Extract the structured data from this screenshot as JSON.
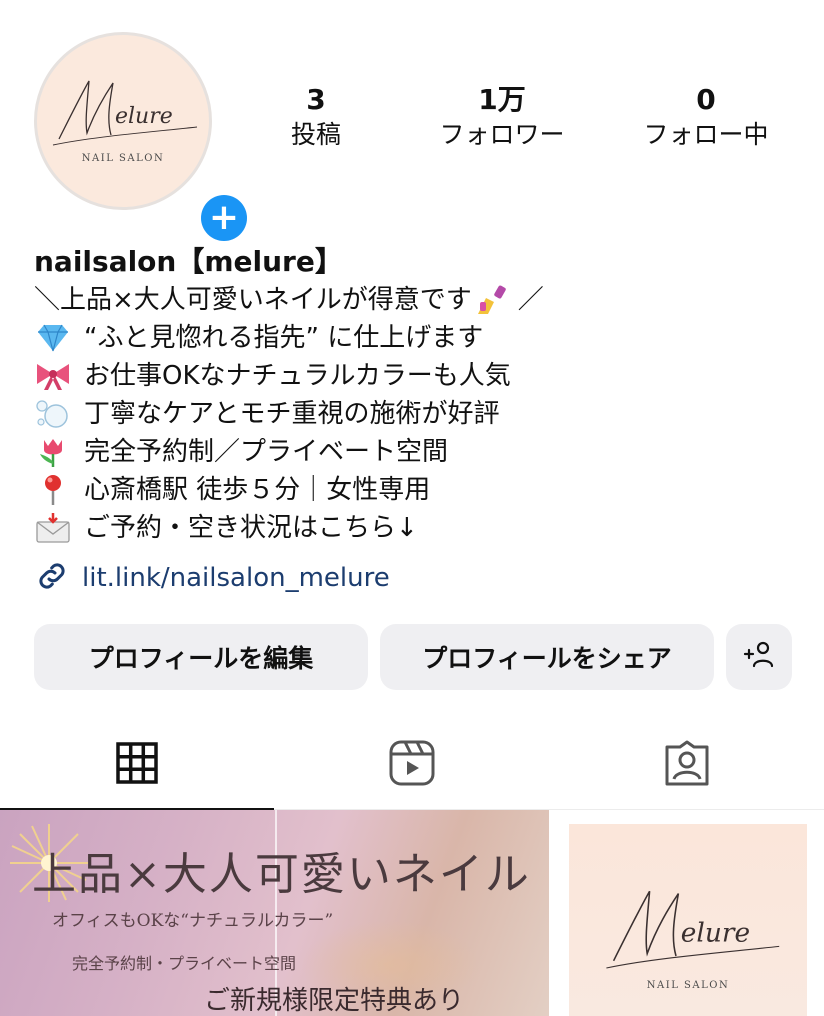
{
  "profile": {
    "logo_text": "Melure",
    "logo_sub": "NAIL SALON",
    "name": "nailsalon【melure】"
  },
  "stats": [
    {
      "value": "3",
      "label": "投稿"
    },
    {
      "value": "1万",
      "label": "フォロワー"
    },
    {
      "value": "0",
      "label": "フォロー中"
    }
  ],
  "bio": [
    {
      "icon": "nail-polish-icon",
      "text": "＼上品×大人可愛いネイルが得意です",
      "suffix": "／"
    },
    {
      "icon": "gem-icon",
      "text": "“ふと見惚れる指先” に仕上げます"
    },
    {
      "icon": "ribbon-icon",
      "text": "お仕事OKなナチュラルカラーも人気"
    },
    {
      "icon": "bubbles-icon",
      "text": "丁寧なケアとモチ重視の施術が好評"
    },
    {
      "icon": "tulip-icon",
      "text": "完全予約制／プライベート空間"
    },
    {
      "icon": "pin-icon",
      "text": "心斎橋駅 徒歩５分｜女性専用"
    },
    {
      "icon": "envelope-icon",
      "text": "ご予約・空き状況はこちら↓"
    }
  ],
  "link": {
    "icon": "link-icon",
    "text": "lit.link/nailsalon_melure"
  },
  "buttons": {
    "edit": "プロフィールを編集",
    "share": "プロフィールをシェア",
    "discover_icon": "add-person-icon"
  },
  "tabs": [
    {
      "icon": "grid-icon",
      "active": true
    },
    {
      "icon": "reels-icon",
      "active": false
    },
    {
      "icon": "tagged-icon",
      "active": false
    }
  ],
  "posts": {
    "post1": {
      "headline": "上品×大人可愛いネイル",
      "line1": "オフィスもOKな“ナチュラルカラー”",
      "line2": "完全予約制・プライベート空間",
      "line3": "ご新規様限定特典あり"
    },
    "post3": {
      "logo_text": "Melure",
      "logo_sub": "NAIL SALON"
    }
  },
  "colors": {
    "accent_blue": "#1a95f5",
    "link_blue": "#1c3d6f",
    "button_bg": "#efeff2",
    "avatar_bg": "#fbe9dd"
  }
}
